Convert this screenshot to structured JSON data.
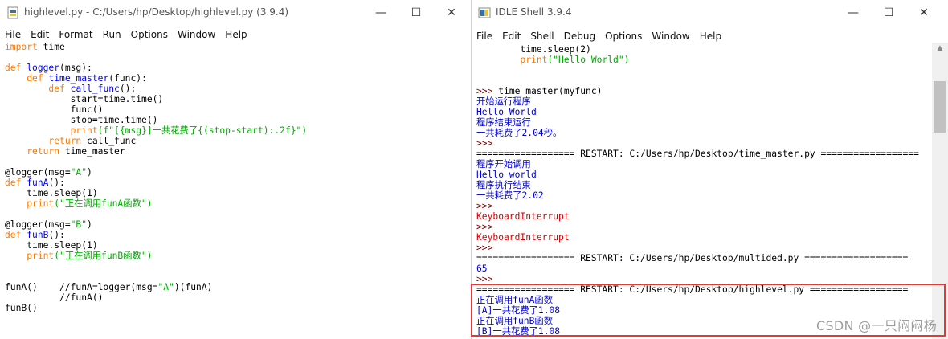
{
  "editor": {
    "title": "highlevel.py - C:/Users/hp/Desktop/highlevel.py (3.9.4)",
    "menu": [
      "File",
      "Edit",
      "Format",
      "Run",
      "Options",
      "Window",
      "Help"
    ],
    "lines": [
      [
        [
          "k",
          "import"
        ],
        [
          "n",
          " time"
        ]
      ],
      [],
      [
        [
          "k",
          "def"
        ],
        [
          "n",
          " "
        ],
        [
          "d",
          "logger"
        ],
        [
          "n",
          "(msg):"
        ]
      ],
      [
        [
          "n",
          "    "
        ],
        [
          "k",
          "def"
        ],
        [
          "n",
          " "
        ],
        [
          "d",
          "time_master"
        ],
        [
          "n",
          "(func):"
        ]
      ],
      [
        [
          "n",
          "        "
        ],
        [
          "k",
          "def"
        ],
        [
          "n",
          " "
        ],
        [
          "d",
          "call_func"
        ],
        [
          "n",
          "():"
        ]
      ],
      [
        [
          "n",
          "            start=time.time()"
        ]
      ],
      [
        [
          "n",
          "            func()"
        ]
      ],
      [
        [
          "n",
          "            stop=time.time()"
        ]
      ],
      [
        [
          "n",
          "            "
        ],
        [
          "k",
          "print"
        ],
        [
          "s",
          "(f\"[{msg}]一共花费了{(stop-start):.2f}\")"
        ]
      ],
      [
        [
          "n",
          "        "
        ],
        [
          "k",
          "return"
        ],
        [
          "n",
          " call_func"
        ]
      ],
      [
        [
          "n",
          "    "
        ],
        [
          "k",
          "return"
        ],
        [
          "n",
          " time_master"
        ]
      ],
      [],
      [
        [
          "n",
          "@logger(msg="
        ],
        [
          "s",
          "\"A\""
        ],
        [
          "n",
          ")"
        ]
      ],
      [
        [
          "k",
          "def"
        ],
        [
          "n",
          " "
        ],
        [
          "d",
          "funA"
        ],
        [
          "n",
          "():"
        ]
      ],
      [
        [
          "n",
          "    time.sleep(1)"
        ]
      ],
      [
        [
          "n",
          "    "
        ],
        [
          "k",
          "print"
        ],
        [
          "s",
          "(\"正在调用funA函数\")"
        ]
      ],
      [],
      [
        [
          "n",
          "@logger(msg="
        ],
        [
          "s",
          "\"B\""
        ],
        [
          "n",
          ")"
        ]
      ],
      [
        [
          "k",
          "def"
        ],
        [
          "n",
          " "
        ],
        [
          "d",
          "funB"
        ],
        [
          "n",
          "():"
        ]
      ],
      [
        [
          "n",
          "    time.sleep(1)"
        ]
      ],
      [
        [
          "n",
          "    "
        ],
        [
          "k",
          "print"
        ],
        [
          "s",
          "(\"正在调用funB函数\")"
        ]
      ],
      [],
      [],
      [
        [
          "n",
          "funA()    //funA=logger(msg="
        ],
        [
          "s",
          "\"A\""
        ],
        [
          "n",
          ")(funA)"
        ]
      ],
      [
        [
          "n",
          "          //funA()"
        ]
      ],
      [
        [
          "n",
          "funB()"
        ]
      ]
    ]
  },
  "shell": {
    "title": "IDLE Shell 3.9.4",
    "menu": [
      "File",
      "Edit",
      "Shell",
      "Debug",
      "Options",
      "Window",
      "Help"
    ],
    "lines": [
      [
        [
          "n",
          "        time.sleep(2)"
        ]
      ],
      [
        [
          "n",
          "        "
        ],
        [
          "k",
          "print"
        ],
        [
          "s",
          "(\"Hello World\")"
        ]
      ],
      [],
      [],
      [
        [
          "p",
          ">>> "
        ],
        [
          "n",
          "time_master(myfunc)"
        ]
      ],
      [
        [
          "o",
          "开始运行程序"
        ]
      ],
      [
        [
          "o",
          "Hello World"
        ]
      ],
      [
        [
          "o",
          "程序结束运行"
        ]
      ],
      [
        [
          "o",
          "一共耗费了2.04秒。"
        ]
      ],
      [
        [
          "p",
          ">>>"
        ]
      ],
      [
        [
          "n",
          "================== RESTART: C:/Users/hp/Desktop/time_master.py =================="
        ]
      ],
      [
        [
          "o",
          "程序开始调用"
        ]
      ],
      [
        [
          "o",
          "Hello world"
        ]
      ],
      [
        [
          "o",
          "程序执行结束"
        ]
      ],
      [
        [
          "o",
          "一共耗费了2.02"
        ]
      ],
      [
        [
          "p",
          ">>>"
        ]
      ],
      [
        [
          "e",
          "KeyboardInterrupt"
        ]
      ],
      [
        [
          "p",
          ">>>"
        ]
      ],
      [
        [
          "e",
          "KeyboardInterrupt"
        ]
      ],
      [
        [
          "p",
          ">>>"
        ]
      ],
      [
        [
          "n",
          "================== RESTART: C:/Users/hp/Desktop/multided.py ==================="
        ]
      ],
      [
        [
          "o",
          "65"
        ]
      ],
      [
        [
          "p",
          ">>>"
        ]
      ],
      [
        [
          "n",
          "================== RESTART: C:/Users/hp/Desktop/highlevel.py =================="
        ]
      ],
      [
        [
          "o",
          "正在调用funA函数"
        ]
      ],
      [
        [
          "o",
          "[A]一共花费了1.08"
        ]
      ],
      [
        [
          "o",
          "正在调用funB函数"
        ]
      ],
      [
        [
          "o",
          "[B]一共花费了1.08"
        ]
      ]
    ]
  },
  "window_buttons": {
    "minimize": "—",
    "maximize": "☐",
    "close": "✕"
  },
  "watermark": "CSDN @一只闷闷杨",
  "colors": {
    "keyword": "#ff7700",
    "defname": "#0000ff",
    "string": "#00aa00",
    "stdout": "#0000cc",
    "error": "#dd0000",
    "highlight_border": "#e53935"
  }
}
